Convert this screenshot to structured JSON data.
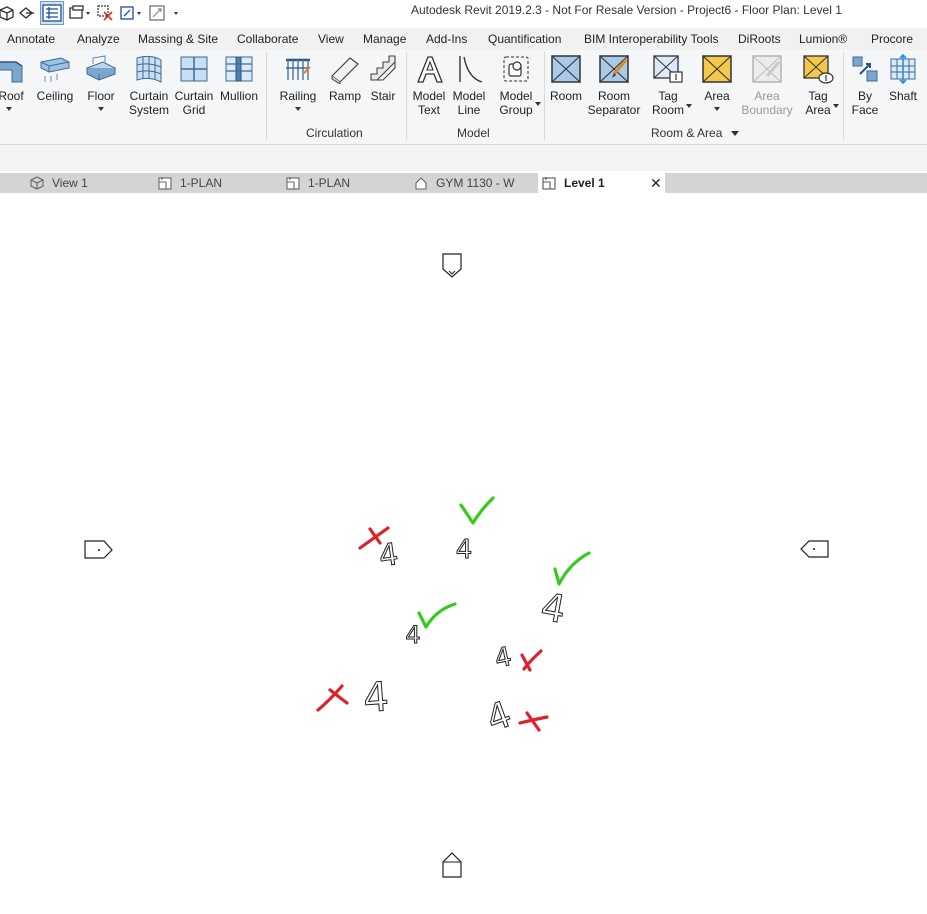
{
  "window": {
    "title": "Autodesk Revit 2019.2.3 - Not For Resale Version - Project6 - Floor Plan: Level 1"
  },
  "ribbon_tabs": [
    {
      "label": "Annotate"
    },
    {
      "label": "Analyze"
    },
    {
      "label": "Massing & Site"
    },
    {
      "label": "Collaborate"
    },
    {
      "label": "View"
    },
    {
      "label": "Manage"
    },
    {
      "label": "Add-Ins"
    },
    {
      "label": "Quantification"
    },
    {
      "label": "BIM Interoperability Tools"
    },
    {
      "label": "DiRoots"
    },
    {
      "label": "Lumion®"
    },
    {
      "label": "Procore"
    }
  ],
  "ribbon": {
    "tools": [
      {
        "label": "Roof",
        "icon": "roof-icon"
      },
      {
        "label": "Ceiling",
        "icon": "ceiling-icon"
      },
      {
        "label": "Floor",
        "icon": "floor-icon"
      },
      {
        "label": "Curtain",
        "label2": "System",
        "icon": "curtain-system-icon"
      },
      {
        "label": "Curtain",
        "label2": "Grid",
        "icon": "curtain-grid-icon"
      },
      {
        "label": "Mullion",
        "icon": "mullion-icon"
      },
      {
        "label": "Railing",
        "icon": "railing-icon"
      },
      {
        "label": "Ramp",
        "icon": "ramp-icon"
      },
      {
        "label": "Stair",
        "icon": "stair-icon"
      },
      {
        "label": "Model",
        "label2": "Text",
        "icon": "model-text-icon"
      },
      {
        "label": "Model",
        "label2": "Line",
        "icon": "model-line-icon"
      },
      {
        "label": "Model",
        "label2": "Group",
        "icon": "model-group-icon"
      },
      {
        "label": "Room",
        "icon": "room-icon"
      },
      {
        "label": "Room",
        "label2": "Separator",
        "icon": "room-separator-icon"
      },
      {
        "label": "Tag",
        "label2": "Room",
        "icon": "tag-room-icon"
      },
      {
        "label": "Area",
        "icon": "area-icon"
      },
      {
        "label": "Area",
        "label2": "Boundary",
        "icon": "area-boundary-icon",
        "disabled": true
      },
      {
        "label": "Tag",
        "label2": "Area",
        "icon": "tag-area-icon"
      },
      {
        "label": "By",
        "label2": "Face",
        "icon": "by-face-icon"
      },
      {
        "label": "Shaft",
        "icon": "shaft-icon"
      }
    ],
    "panels": [
      {
        "label": "Circulation"
      },
      {
        "label": "Model"
      },
      {
        "label": "Room & Area"
      }
    ]
  },
  "view_tabs": [
    {
      "label": "View 1",
      "icon": "3d-view-icon"
    },
    {
      "label": "1-PLAN",
      "icon": "plan-view-icon"
    },
    {
      "label": "1-PLAN",
      "icon": "plan-view-icon"
    },
    {
      "label": "GYM 1130 - W",
      "icon": "elevation-view-icon"
    },
    {
      "label": "Level 1",
      "icon": "plan-view-icon",
      "active": true
    }
  ],
  "view_close": "✕",
  "canvas": {
    "text_glyphs": [
      {
        "text": "4",
        "status": "wrong"
      },
      {
        "text": "4",
        "status": "correct"
      },
      {
        "text": "4",
        "status": "correct"
      },
      {
        "text": "4",
        "status": "correct"
      },
      {
        "text": "4",
        "status": "wrong"
      },
      {
        "text": "4",
        "status": "wrong"
      },
      {
        "text": "4",
        "status": "wrong"
      }
    ],
    "annotation_colors": {
      "correct": "#33cc1a",
      "wrong": "#e0202a"
    },
    "elevation_markers": [
      "north",
      "south",
      "east",
      "west"
    ]
  }
}
